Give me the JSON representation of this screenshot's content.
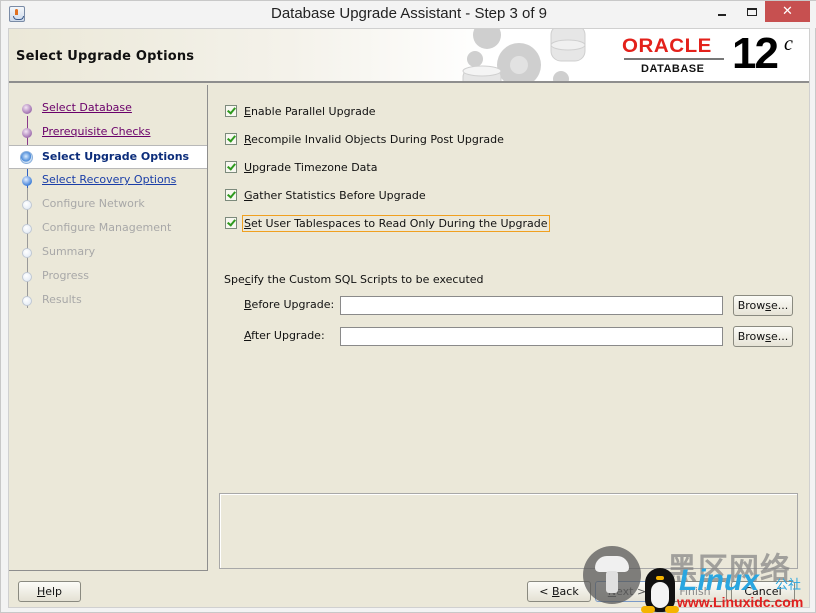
{
  "window": {
    "title": "Database Upgrade Assistant - Step 3 of 9",
    "controls": {
      "minimize": "minimize",
      "maximize": "maximize",
      "close": "✕"
    }
  },
  "header": {
    "title": "Select Upgrade Options",
    "logo": {
      "brand": "ORACLE",
      "registered": "®",
      "product": "DATABASE",
      "version": "12",
      "version_suffix": "c"
    },
    "brand_color": "#e3211b"
  },
  "sidebar": {
    "steps": [
      {
        "label": "Select Database",
        "state": "done"
      },
      {
        "label": "Prerequisite Checks",
        "state": "done"
      },
      {
        "label": "Select Upgrade Options",
        "state": "current"
      },
      {
        "label": "Select Recovery Options",
        "state": "next"
      },
      {
        "label": "Configure Network",
        "state": "future"
      },
      {
        "label": "Configure Management",
        "state": "future"
      },
      {
        "label": "Summary",
        "state": "future"
      },
      {
        "label": "Progress",
        "state": "future"
      },
      {
        "label": "Results",
        "state": "future"
      }
    ]
  },
  "options": [
    {
      "mnemonic": "E",
      "rest": "nable Parallel Upgrade",
      "checked": true
    },
    {
      "mnemonic": "R",
      "rest": "ecompile Invalid Objects During Post Upgrade",
      "checked": true
    },
    {
      "mnemonic": "U",
      "rest": "pgrade Timezone Data",
      "checked": true
    },
    {
      "mnemonic": "G",
      "rest": "ather Statistics Before Upgrade",
      "checked": true
    },
    {
      "mnemonic": "S",
      "rest": "et User Tablespaces to Read Only During the Upgrade",
      "checked": true,
      "focused": true
    }
  ],
  "scripts": {
    "section_label_pre": "Spe",
    "section_label_mn": "c",
    "section_label_post": "ify the Custom SQL Scripts to be executed",
    "before": {
      "mn": "B",
      "rest": "efore Upgrade:",
      "value": ""
    },
    "after": {
      "mn": "A",
      "rest": "fter Upgrade:",
      "value": ""
    },
    "browse_pre": "Brow",
    "browse_mn": "s",
    "browse_post": "e..."
  },
  "footer": {
    "help": {
      "mn": "H",
      "rest": "elp"
    },
    "back": {
      "pre": "< ",
      "mn": "B",
      "rest": "ack"
    },
    "next": {
      "mn": "N",
      "rest": "ext >"
    },
    "finish": "Finish",
    "cancel": "Cancel"
  },
  "watermark": {
    "cn_text": "黑区网络",
    "brand": "Linux",
    "brand_suffix": "公社",
    "url": "www.Linuxidc.com"
  }
}
